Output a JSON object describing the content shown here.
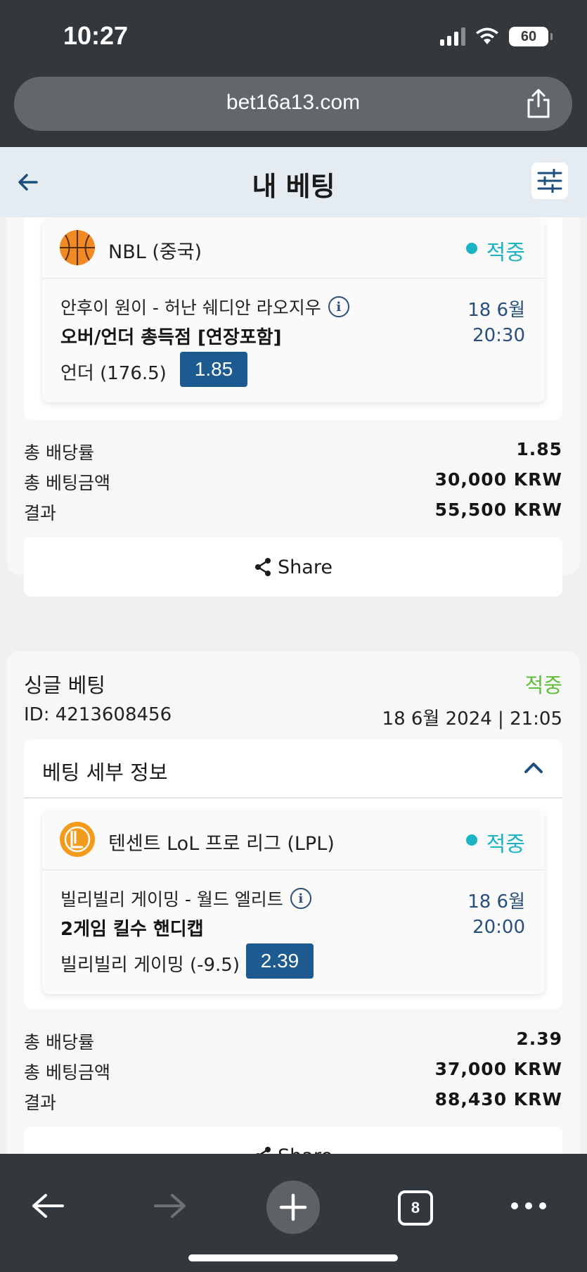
{
  "status_bar": {
    "time": "10:27",
    "battery": "60"
  },
  "browser": {
    "url": "bet16a13.com",
    "tab_count": "8"
  },
  "header": {
    "title": "내 베팅"
  },
  "bets": [
    {
      "selection": {
        "league": "NBL (중국)",
        "status": "적중",
        "match": "안후이 원이 - 허난 쉐디안 라오지우",
        "date": "18 6월",
        "time": "20:30",
        "market": "오버/언더 총득점 [연장포함]",
        "pick": "언더 (176.5)",
        "odds": "1.85"
      },
      "summary": [
        {
          "label": "총 배당률",
          "value": "1.85"
        },
        {
          "label": "총 베팅금액",
          "value": "30,000 KRW"
        },
        {
          "label": "결과",
          "value": "55,500 KRW"
        }
      ],
      "share_label": "Share"
    },
    {
      "type": "싱글 베팅",
      "status": "적중",
      "id": "ID: 4213608456",
      "placed": "18 6월 2024 | 21:05",
      "details_title": "베팅 세부 정보",
      "selection": {
        "league": "텐센트 LoL 프로 리그 (LPL)",
        "status": "적중",
        "match": "빌리빌리 게이밍 - 월드 엘리트",
        "date": "18 6월",
        "time": "20:00",
        "market": "2게임 킬수 핸디캡",
        "pick": "빌리빌리 게이밍 (-9.5)",
        "odds": "2.39"
      },
      "summary": [
        {
          "label": "총 배당률",
          "value": "2.39"
        },
        {
          "label": "총 베팅금액",
          "value": "37,000 KRW"
        },
        {
          "label": "결과",
          "value": "88,430 KRW"
        }
      ],
      "share_label": "Share"
    }
  ],
  "colors": {
    "win": "#1cb4c4",
    "win_text": "#5fbf3a",
    "odds_bg": "#1d5a8f",
    "accent": "#2a4f7a"
  },
  "icons": [
    "back-arrow-icon",
    "filter-sliders-icon",
    "basketball-icon",
    "lol-league-icon",
    "info-icon",
    "share-icon",
    "chevron-up-icon",
    "ios-share-icon",
    "plus-icon",
    "forward-arrow-icon",
    "more-icon"
  ]
}
